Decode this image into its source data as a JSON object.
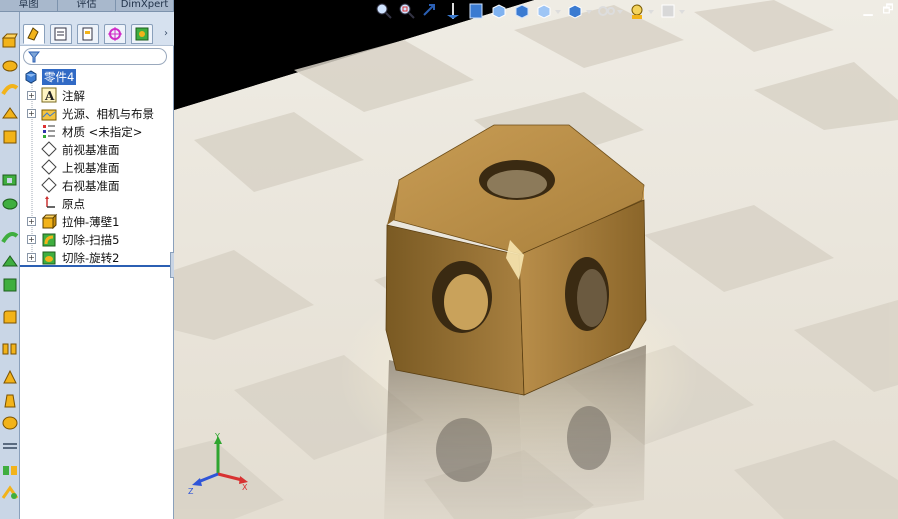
{
  "top_tabs": [
    {
      "label": "草图"
    },
    {
      "label": "评估"
    },
    {
      "label": "DimXpert"
    }
  ],
  "feature_tree": {
    "root": {
      "label": "零件4",
      "icon": "part-icon"
    },
    "items": [
      {
        "label": "注解",
        "icon": "annotation-icon",
        "expandable": true
      },
      {
        "label": "光源、相机与布景",
        "icon": "lights-cameras-icon",
        "expandable": true
      },
      {
        "label": "材质 <未指定>",
        "icon": "material-icon",
        "expandable": false
      },
      {
        "label": "前视基准面",
        "icon": "plane-icon",
        "expandable": false
      },
      {
        "label": "上视基准面",
        "icon": "plane-icon",
        "expandable": false
      },
      {
        "label": "右视基准面",
        "icon": "plane-icon",
        "expandable": false
      },
      {
        "label": "原点",
        "icon": "origin-icon",
        "expandable": false
      },
      {
        "label": "拉伸-薄壁1",
        "icon": "extrude-icon",
        "expandable": true
      },
      {
        "label": "切除-扫描5",
        "icon": "sweep-cut-icon",
        "expandable": true
      },
      {
        "label": "切除-旋转2",
        "icon": "revolve-cut-icon",
        "expandable": true
      }
    ]
  },
  "fm_tabs": [
    {
      "icon": "feature-manager-icon"
    },
    {
      "icon": "property-manager-icon"
    },
    {
      "icon": "configuration-manager-icon"
    },
    {
      "icon": "dimxpert-manager-icon"
    },
    {
      "icon": "display-manager-icon"
    }
  ],
  "hud_tools": [
    {
      "icon": "zoom-to-fit-icon"
    },
    {
      "icon": "zoom-to-area-icon"
    },
    {
      "icon": "previous-view-icon"
    },
    {
      "icon": "section-view-icon"
    },
    {
      "icon": "dynamic-annotation-icon"
    },
    {
      "icon": "view-orientation-icon"
    },
    {
      "icon": "display-style-icon"
    },
    {
      "icon": "hide-show-items-icon"
    },
    {
      "icon": "edit-appearance-icon"
    },
    {
      "icon": "apply-scene-icon"
    },
    {
      "icon": "view-settings-icon"
    },
    {
      "icon": "lighting-icon"
    },
    {
      "icon": "render-tools-icon"
    }
  ],
  "triad": {
    "x": "X",
    "y": "Y",
    "z": "Z"
  },
  "window_controls": {
    "minimize": "▁",
    "restore": "🗗"
  },
  "colors": {
    "floor_light": "#f2efe8",
    "floor_dark": "#d8d3c8",
    "part_gold": "#b8893f",
    "tree_selection": "#316ac5"
  }
}
